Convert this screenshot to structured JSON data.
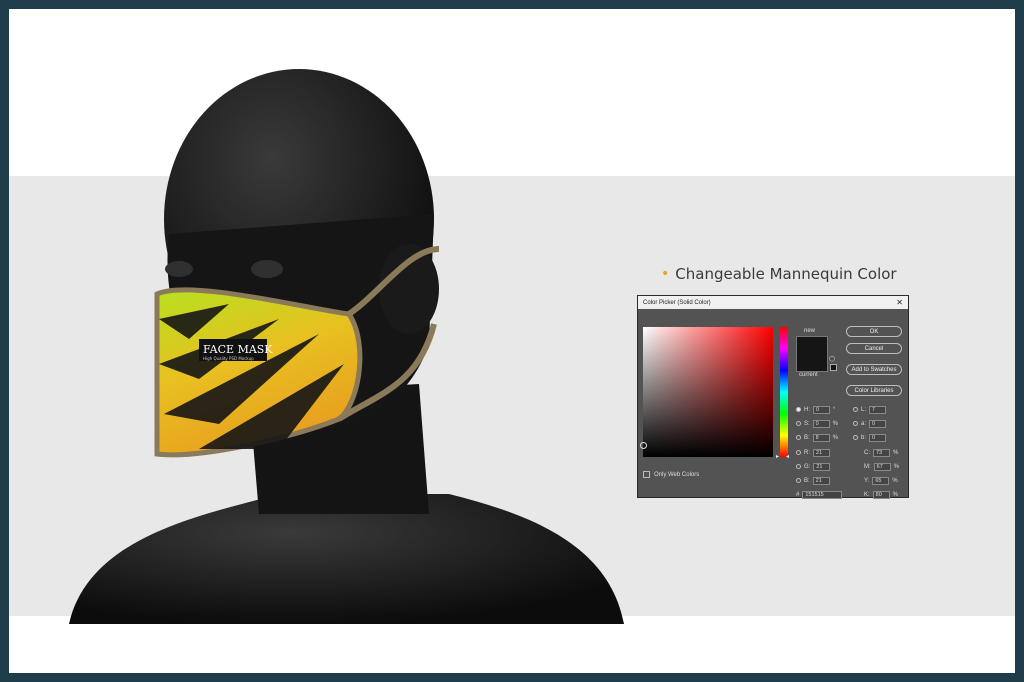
{
  "headline": {
    "bullet": "•",
    "text": "Changeable Mannequin Color"
  },
  "mask": {
    "brand": "FACE MASK",
    "tagline": "High Quality PSD Mockup"
  },
  "dialog": {
    "title": "Color Picker (Solid Color)",
    "close": "✕",
    "new_label": "new",
    "current_label": "current",
    "color": "#151515",
    "buttons": {
      "ok": "OK",
      "cancel": "Cancel",
      "swatches": "Add to Swatches",
      "libraries": "Color Libraries"
    },
    "hsb": [
      {
        "label": "H:",
        "value": "0",
        "unit": "°"
      },
      {
        "label": "S:",
        "value": "0",
        "unit": "%"
      },
      {
        "label": "B:",
        "value": "8",
        "unit": "%"
      }
    ],
    "rgb": [
      {
        "label": "R:",
        "value": "21"
      },
      {
        "label": "G:",
        "value": "21"
      },
      {
        "label": "B:",
        "value": "21"
      }
    ],
    "lab": [
      {
        "label": "L:",
        "value": "7"
      },
      {
        "label": "a:",
        "value": "0"
      },
      {
        "label": "b:",
        "value": "0"
      }
    ],
    "cmyk": [
      {
        "label": "C:",
        "value": "73",
        "unit": "%"
      },
      {
        "label": "M:",
        "value": "67",
        "unit": "%"
      },
      {
        "label": "Y:",
        "value": "65",
        "unit": "%"
      },
      {
        "label": "K:",
        "value": "80",
        "unit": "%"
      }
    ],
    "hex": {
      "label": "#",
      "value": "151515"
    },
    "only_web_colors": "Only Web Colors"
  }
}
